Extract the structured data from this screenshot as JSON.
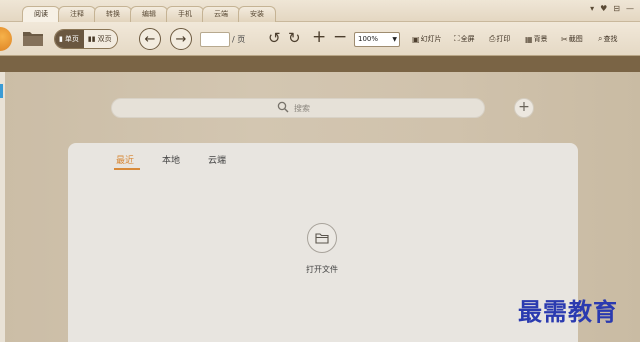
{
  "tabs": [
    "阅读",
    "注释",
    "转换",
    "编辑",
    "手机",
    "云端",
    "安装"
  ],
  "window_controls": [
    "▾",
    "♥",
    "⊟",
    "—"
  ],
  "toolbar": {
    "view_single": "单页",
    "view_double": "双页",
    "page_suffix": "/ 页",
    "zoom_value": "100%",
    "tools": [
      {
        "icon": "slideshow-icon",
        "glyph": "▣",
        "label": "幻灯片"
      },
      {
        "icon": "fullscreen-icon",
        "glyph": "⛶",
        "label": "全屏"
      },
      {
        "icon": "print-icon",
        "glyph": "⎙",
        "label": "打印"
      },
      {
        "icon": "background-icon",
        "glyph": "▦",
        "label": "背景"
      },
      {
        "icon": "screenshot-icon",
        "glyph": "✂",
        "label": "截图"
      },
      {
        "icon": "find-icon",
        "glyph": "⌕",
        "label": "查找"
      }
    ]
  },
  "search": {
    "placeholder": "搜索"
  },
  "panel": {
    "tabs": [
      "最近",
      "本地",
      "云端"
    ],
    "active_tab": "最近",
    "open_file_label": "打开文件"
  },
  "watermark": "最需教育",
  "colors": {
    "accent": "#d88a3a",
    "band": "#7a6445",
    "watermark": "#2a3ab0"
  }
}
